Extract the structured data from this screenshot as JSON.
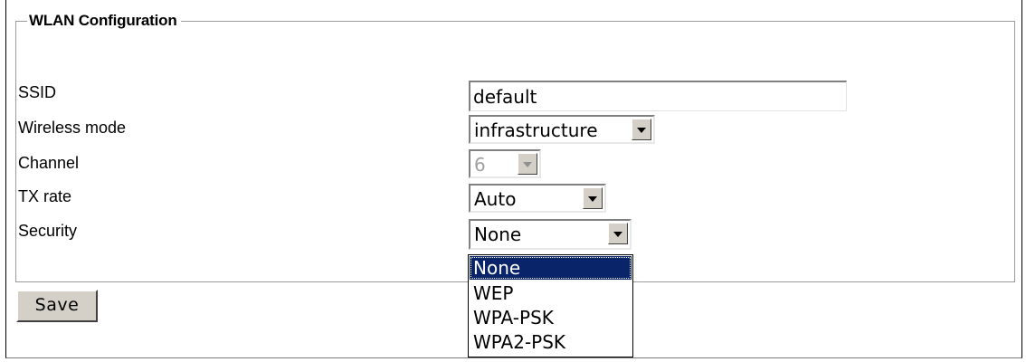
{
  "fieldset": {
    "legend": "WLAN Configuration"
  },
  "fields": {
    "ssid": {
      "label": "SSID",
      "value": "default"
    },
    "wireless_mode": {
      "label": "Wireless mode",
      "value": "infrastructure"
    },
    "channel": {
      "label": "Channel",
      "value": "6",
      "disabled": true
    },
    "tx_rate": {
      "label": "TX rate",
      "value": "Auto"
    },
    "security": {
      "label": "Security",
      "value": "None",
      "dropdown_open": true,
      "options": [
        "None",
        "WEP",
        "WPA-PSK",
        "WPA2-PSK"
      ],
      "highlighted_option": "None"
    }
  },
  "actions": {
    "save_label": "Save"
  },
  "colors": {
    "highlight_bg": "#0a246a",
    "button_face": "#d4d0c8",
    "disabled_text": "#a0a0a0"
  },
  "icons": {
    "dropdown_arrow": "chevron-down-icon"
  }
}
